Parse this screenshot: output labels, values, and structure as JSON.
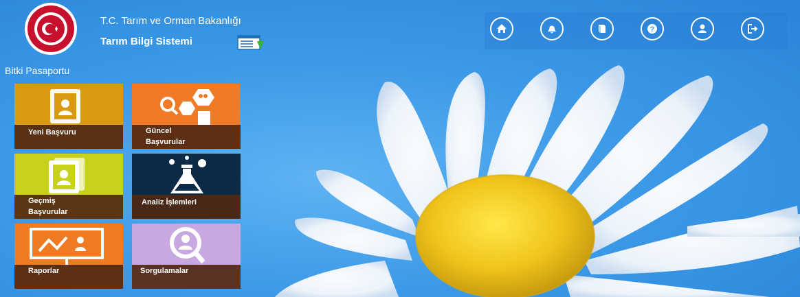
{
  "header": {
    "ministry_name": "T.C. Tarım ve Orman Bakanlığı",
    "system_name": "Tarım Bilgi Sistemi"
  },
  "toolbar": {
    "buttons": [
      {
        "name": "home-button",
        "icon": "home-icon"
      },
      {
        "name": "notifications-button",
        "icon": "bell-icon"
      },
      {
        "name": "manual-button",
        "icon": "book-icon"
      },
      {
        "name": "help-button",
        "icon": "question-icon"
      },
      {
        "name": "profile-button",
        "icon": "user-icon"
      },
      {
        "name": "logout-button",
        "icon": "logout-icon"
      }
    ]
  },
  "section": {
    "title": "Bitki Pasaportu"
  },
  "tiles": [
    {
      "label": "Yeni Başvuru",
      "color": "#d99a12",
      "icon": "applicant-card-icon"
    },
    {
      "label": "Güncel\nBaşvurular",
      "color": "#f07a25",
      "icon": "search-users-documents-icon"
    },
    {
      "label": "Geçmiş\nBaşvurular",
      "color": "#c8d21c",
      "icon": "applicant-card-stack-icon"
    },
    {
      "label": "Analiz İşlemleri",
      "color": "#0b2a45",
      "icon": "flask-icon"
    },
    {
      "label": "Raporlar",
      "color": "#ee7a22",
      "icon": "report-chart-icon"
    },
    {
      "label": "Sorgulamalar",
      "color": "#c7a8e0",
      "icon": "search-user-icon"
    }
  ],
  "colors": {
    "sky": "#3d9ae8",
    "tile_label_bar": "#502814"
  }
}
